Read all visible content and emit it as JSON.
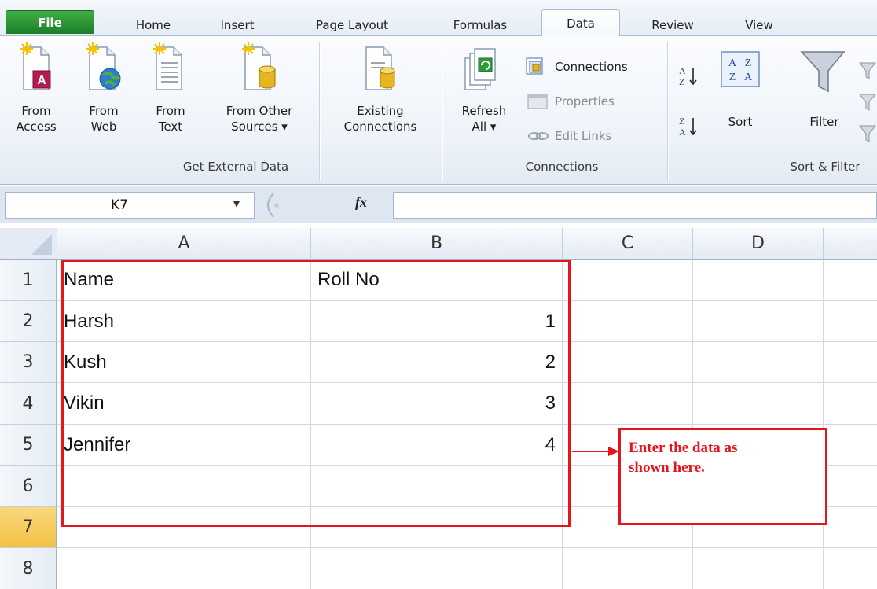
{
  "tabs": [
    "File",
    "Home",
    "Insert",
    "Page Layout",
    "Formulas",
    "Data",
    "Review",
    "View"
  ],
  "active_tab": "Data",
  "ribbon": {
    "get_external_data": {
      "label": "Get External Data",
      "from_access": [
        "From",
        "Access"
      ],
      "from_web": [
        "From",
        "Web"
      ],
      "from_text": [
        "From",
        "Text"
      ],
      "from_other": [
        "From Other",
        "Sources ▾"
      ]
    },
    "existing_connections": [
      "Existing",
      "Connections"
    ],
    "connections": {
      "label": "Connections",
      "refresh_all": [
        "Refresh",
        "All ▾"
      ],
      "connections": "Connections",
      "properties": "Properties",
      "edit_links": "Edit Links"
    },
    "sort_filter": {
      "label": "Sort & Filter",
      "sort": "Sort",
      "filter": "Filter"
    }
  },
  "formula_bar": {
    "name_box": "K7",
    "fx": "fx",
    "value": ""
  },
  "grid": {
    "columns": [
      "A",
      "B",
      "C",
      "D"
    ],
    "rows": [
      "1",
      "2",
      "3",
      "4",
      "5",
      "6",
      "7",
      "8"
    ],
    "selected_row": "7",
    "cells": [
      [
        "Name",
        "Roll No"
      ],
      [
        "Harsh",
        "1"
      ],
      [
        "Kush",
        "2"
      ],
      [
        "Vikin",
        "3"
      ],
      [
        "Jennifer",
        "4"
      ]
    ]
  },
  "annotation": {
    "line1": "Enter the data as",
    "line2": "shown here.",
    "color": "#e8141c"
  }
}
